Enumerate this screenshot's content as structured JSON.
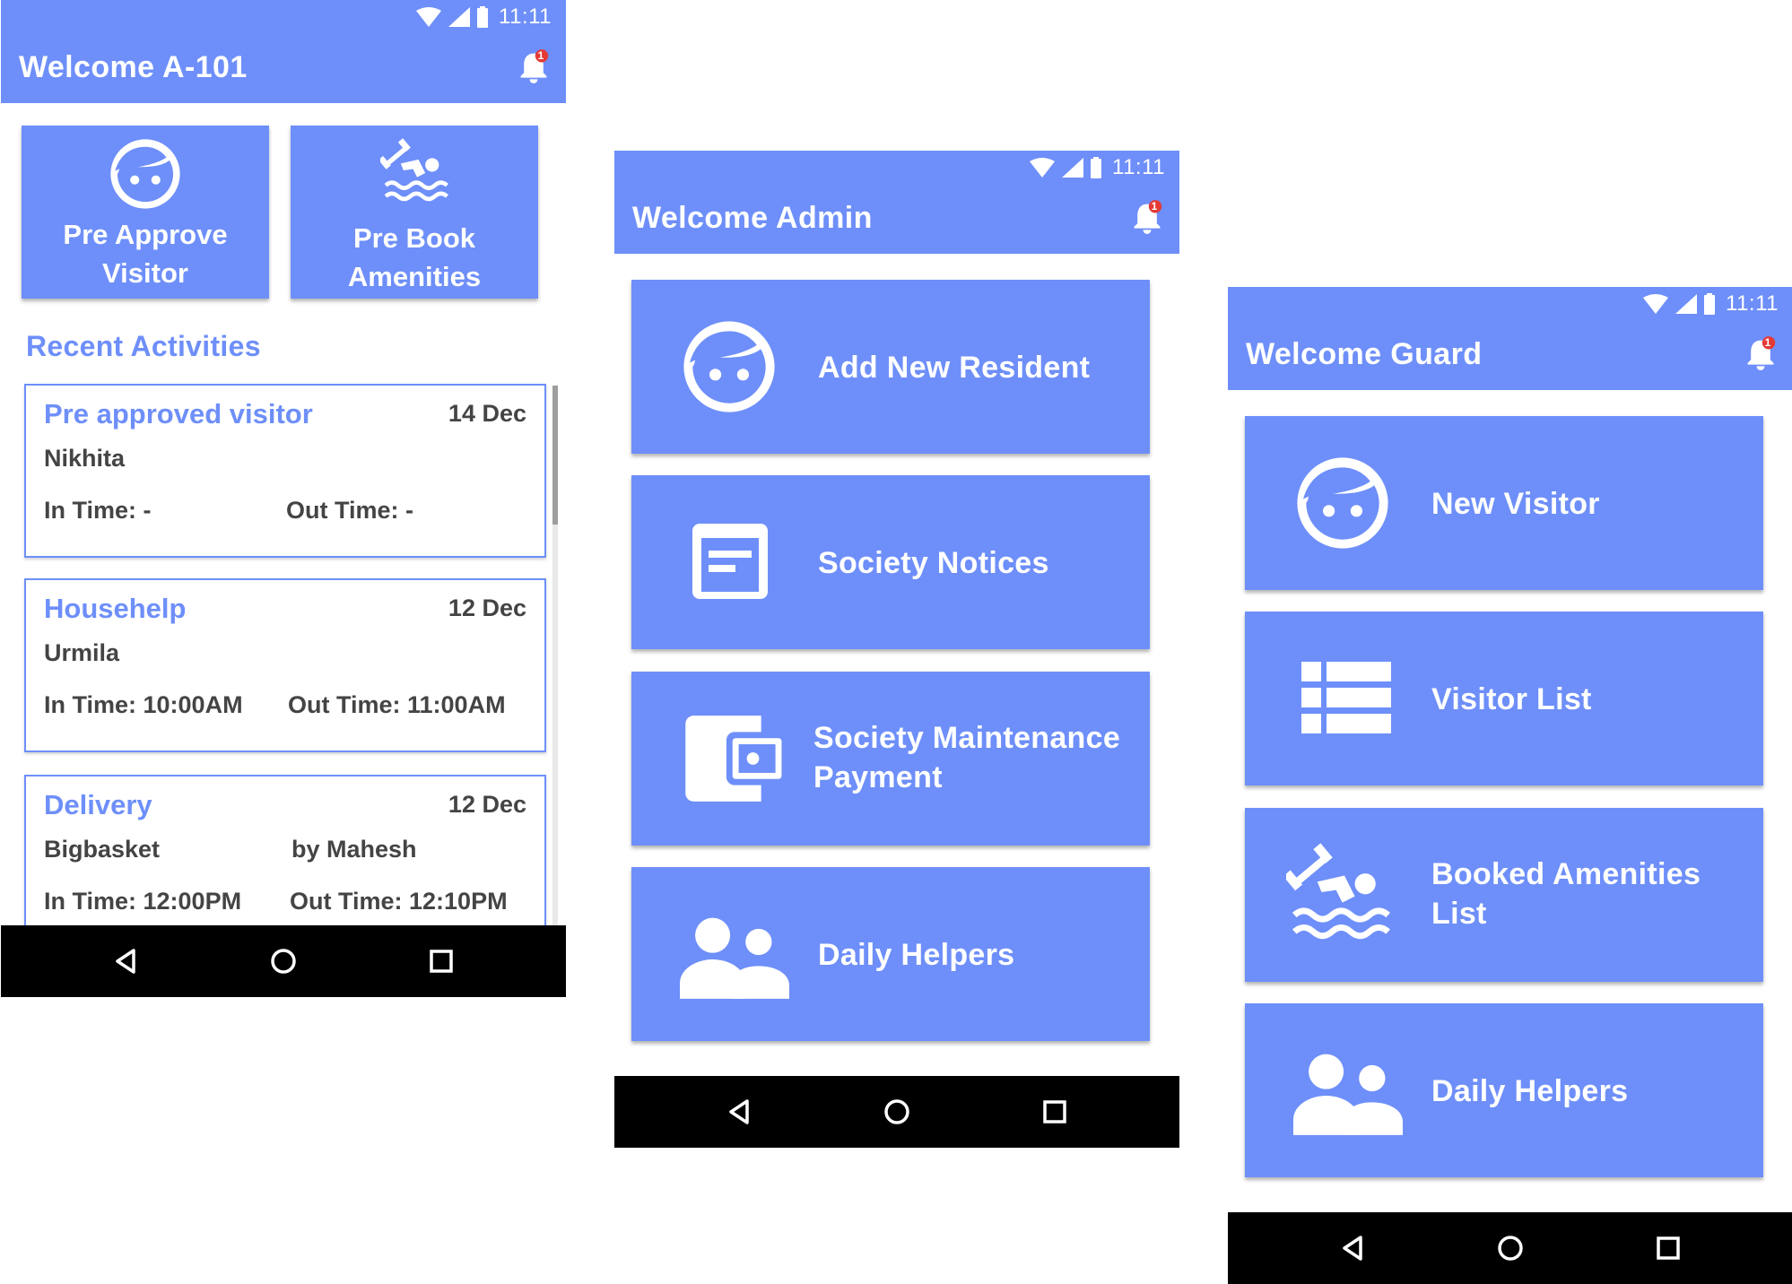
{
  "status": {
    "time": "11:11"
  },
  "notification_count": "1",
  "resident": {
    "title": "Welcome A-101",
    "tiles": [
      {
        "label_line1": "Pre Approve",
        "label_line2": "Visitor",
        "icon": "face-icon"
      },
      {
        "label_line1": "Pre Book",
        "label_line2": "Amenities",
        "icon": "swimming-icon"
      }
    ],
    "section_title": "Recent Activities",
    "activities": [
      {
        "title": "Pre approved visitor",
        "date": "14 Dec",
        "name": "Nikhita",
        "by": "",
        "in": "In Time: -",
        "out": "Out Time: -"
      },
      {
        "title": "Househelp",
        "date": "12 Dec",
        "name": "Urmila",
        "by": "",
        "in": "In Time: 10:00AM",
        "out": "Out Time: 11:00AM"
      },
      {
        "title": "Delivery",
        "date": "12 Dec",
        "name": "Bigbasket",
        "by": "by Mahesh",
        "in": "In Time: 12:00PM",
        "out": "Out Time: 12:10PM"
      }
    ]
  },
  "admin": {
    "title": "Welcome Admin",
    "tiles": [
      {
        "label": "Add New Resident",
        "icon": "face-icon"
      },
      {
        "label": "Society Notices",
        "icon": "notice-icon"
      },
      {
        "label_line1": "Society Maintenance",
        "label_line2": "Payment",
        "icon": "wallet-icon"
      },
      {
        "label": "Daily Helpers",
        "icon": "people-icon"
      }
    ]
  },
  "guard": {
    "title": "Welcome Guard",
    "tiles": [
      {
        "label": "New Visitor",
        "icon": "face-icon"
      },
      {
        "label": "Visitor List",
        "icon": "list-icon"
      },
      {
        "label_line1": "Booked Amenities",
        "label_line2": "List",
        "icon": "swimming-icon"
      },
      {
        "label": "Daily Helpers",
        "icon": "people-icon"
      }
    ]
  },
  "colors": {
    "primary": "#6e8ff9",
    "badge": "#e53935",
    "navbar": "#000000"
  }
}
